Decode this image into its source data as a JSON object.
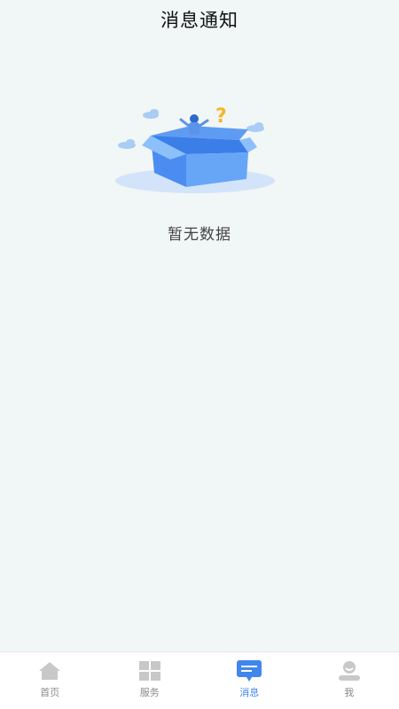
{
  "header": {
    "title": "消息通知"
  },
  "empty_state": {
    "message": "暂无数据",
    "illustration_icon": "empty-box-question-illustration"
  },
  "tabbar": {
    "active_color": "#3f86ee",
    "inactive_color": "#c8c8c8",
    "tabs": [
      {
        "label": "首页",
        "icon": "home-icon",
        "active": false
      },
      {
        "label": "服务",
        "icon": "grid-icon",
        "active": false
      },
      {
        "label": "消息",
        "icon": "message-icon",
        "active": true
      },
      {
        "label": "我",
        "icon": "user-icon",
        "active": false
      }
    ]
  }
}
